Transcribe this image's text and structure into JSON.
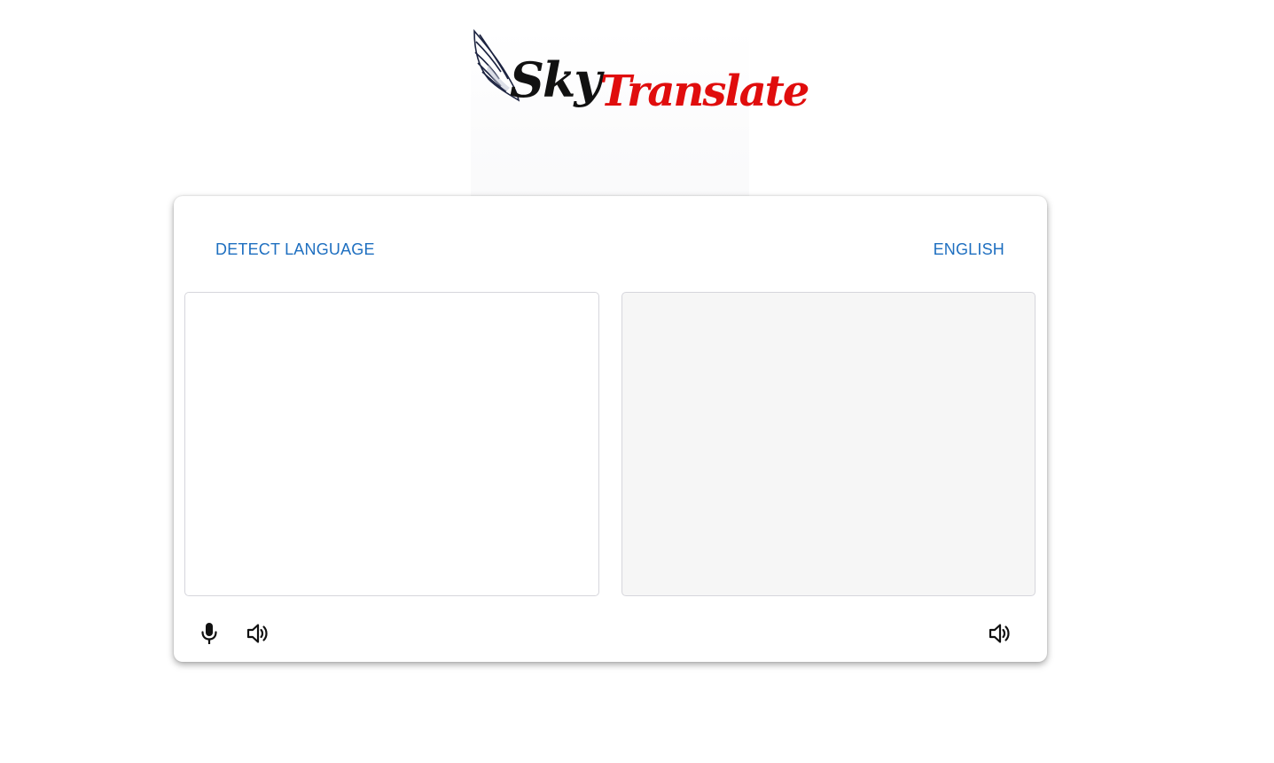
{
  "logo": {
    "brand_part1": "Sky",
    "brand_part2": "Translate",
    "wing_icon": "wing-icon",
    "colors": {
      "sky": "#111111",
      "translate": "#e00d0d"
    }
  },
  "translator": {
    "source_language": "DETECT LANGUAGE",
    "target_language": "ENGLISH",
    "source_text": "",
    "target_text": "",
    "icons": {
      "microphone": "microphone-icon",
      "speak_source": "volume-icon",
      "speak_target": "volume-icon"
    },
    "accent_color": "#1e6fc0"
  }
}
